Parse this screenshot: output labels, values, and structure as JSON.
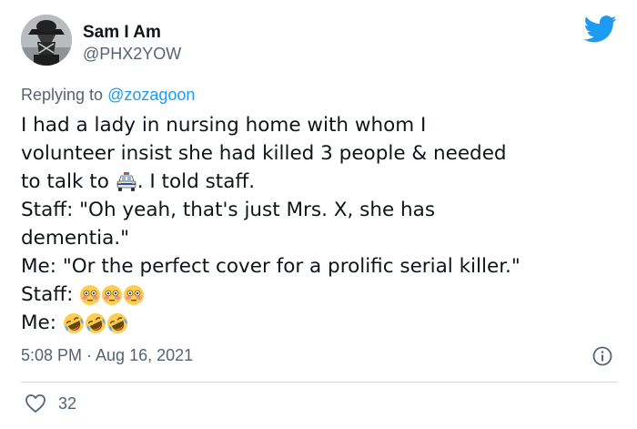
{
  "user": {
    "display_name": "Sam I Am",
    "handle": "@PHX2YOW"
  },
  "reply": {
    "prefix": "Replying to ",
    "mention": "@zozagoon"
  },
  "tweet": {
    "line1": "I had a lady in nursing home with whom I",
    "line2": "volunteer insist she had killed 3 people & needed",
    "line3_before": "to talk to ",
    "line3_emoji": "police-car-emoji",
    "line3_after": ". I told staff.",
    "line4": "Staff: \"Oh yeah, that's just Mrs. X, she has",
    "line5": "dementia.\"",
    "line6": "Me: \"Or the perfect cover for a prolific serial killer.\"",
    "line7_label": "Staff: ",
    "line7_emoji": "flushed-face-emoji",
    "line8_label": "Me: ",
    "line8_emoji": "rolling-on-the-floor-laughing-emoji"
  },
  "meta": {
    "timestamp": "5:08 PM · Aug 16, 2021"
  },
  "engagement": {
    "likes": "32"
  },
  "icons": {
    "brand": "twitter-bird-icon",
    "info": "info-icon",
    "like": "heart-icon"
  },
  "colors": {
    "twitter_blue": "#1d9bf0",
    "text_primary": "#0f1419",
    "text_secondary": "#536471",
    "divider": "#cfd9de"
  }
}
